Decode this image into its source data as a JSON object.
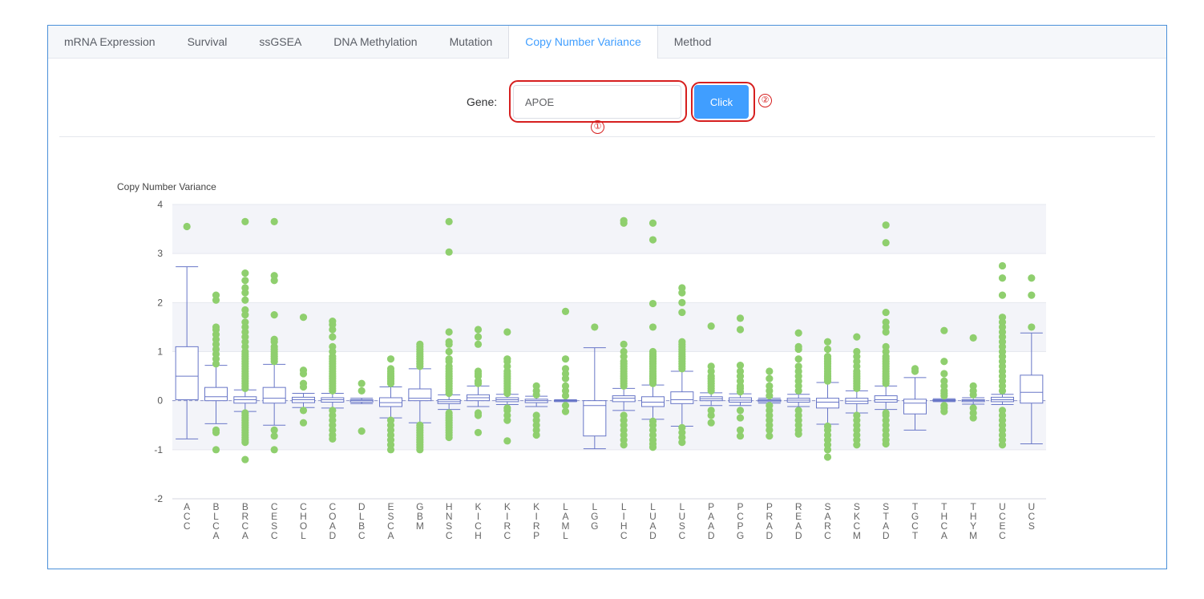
{
  "tabs": [
    {
      "label": "mRNA Expression",
      "active": false
    },
    {
      "label": "Survival",
      "active": false
    },
    {
      "label": "ssGSEA",
      "active": false
    },
    {
      "label": "DNA Methylation",
      "active": false
    },
    {
      "label": "Mutation",
      "active": false
    },
    {
      "label": "Copy Number Variance",
      "active": true
    },
    {
      "label": "Method",
      "active": false
    }
  ],
  "form": {
    "gene_label": "Gene:",
    "gene_value": "APOE",
    "button_label": "Click"
  },
  "annotations": {
    "marker1": "①",
    "marker2": "②",
    "color": "#d61f1f"
  },
  "colors": {
    "accent": "#409eff",
    "box": "#6876c7",
    "outlier": "#8fcf6e",
    "band": "#f3f4f9"
  },
  "chart_data": {
    "type": "boxplot",
    "ylabel": "Copy Number Variance",
    "ylim": [
      -2,
      4
    ],
    "yticks": [
      4,
      3,
      2,
      1,
      0,
      -1,
      -2
    ],
    "series": [
      {
        "cat": "ACC",
        "box": [
          -0.78,
          0.02,
          0.5,
          1.1,
          2.73
        ],
        "outliers": [
          3.55
        ]
      },
      {
        "cat": "BLCA",
        "box": [
          -0.47,
          0.0,
          0.08,
          0.27,
          0.72
        ],
        "outliers": [
          -1.0,
          -0.6,
          -0.65,
          0.75,
          0.85,
          0.95,
          1.05,
          1.15,
          1.25,
          1.35,
          1.45,
          1.5,
          2.05,
          2.15
        ]
      },
      {
        "cat": "BRCA",
        "box": [
          -0.22,
          -0.05,
          0.02,
          0.08,
          0.22
        ],
        "outliers": [
          -1.2,
          -0.85,
          -0.8,
          -0.75,
          -0.7,
          -0.65,
          -0.6,
          -0.55,
          -0.5,
          -0.45,
          -0.4,
          -0.35,
          -0.3,
          -0.25,
          0.25,
          0.3,
          0.35,
          0.4,
          0.45,
          0.5,
          0.55,
          0.6,
          0.65,
          0.7,
          0.75,
          0.8,
          0.85,
          0.9,
          0.95,
          1.0,
          1.1,
          1.2,
          1.3,
          1.4,
          1.5,
          1.6,
          1.75,
          1.85,
          2.05,
          2.2,
          2.3,
          2.45,
          2.6,
          3.65
        ]
      },
      {
        "cat": "CESC",
        "box": [
          -0.5,
          -0.05,
          0.05,
          0.27,
          0.74
        ],
        "outliers": [
          -1.0,
          -0.72,
          -0.6,
          0.8,
          0.85,
          0.9,
          0.95,
          1.0,
          1.05,
          1.1,
          1.2,
          1.25,
          1.75,
          2.45,
          2.55,
          3.65
        ]
      },
      {
        "cat": "CHOL",
        "box": [
          -0.14,
          -0.04,
          0.02,
          0.07,
          0.15
        ],
        "outliers": [
          -0.45,
          -0.2,
          0.28,
          0.35,
          0.55,
          0.62,
          1.7
        ]
      },
      {
        "cat": "COAD",
        "box": [
          -0.15,
          -0.03,
          0.02,
          0.06,
          0.15
        ],
        "outliers": [
          -0.78,
          -0.7,
          -0.6,
          -0.5,
          -0.4,
          -0.3,
          -0.2,
          0.2,
          0.25,
          0.3,
          0.35,
          0.4,
          0.45,
          0.5,
          0.55,
          0.6,
          0.65,
          0.7,
          0.75,
          0.8,
          0.85,
          0.9,
          1.0,
          1.1,
          1.3,
          1.45,
          1.55,
          1.62
        ]
      },
      {
        "cat": "DLBC",
        "box": [
          -0.06,
          -0.03,
          0.0,
          0.02,
          0.05
        ],
        "outliers": [
          -0.62,
          0.2,
          0.35
        ]
      },
      {
        "cat": "ESCA",
        "box": [
          -0.35,
          -0.12,
          -0.04,
          0.06,
          0.28
        ],
        "outliers": [
          -1.0,
          -0.9,
          -0.8,
          -0.7,
          -0.6,
          -0.5,
          -0.4,
          0.35,
          0.4,
          0.45,
          0.5,
          0.55,
          0.6,
          0.65,
          0.85
        ]
      },
      {
        "cat": "GBM",
        "box": [
          -0.45,
          0.0,
          0.05,
          0.24,
          0.65
        ],
        "outliers": [
          -1.0,
          -0.95,
          -0.9,
          -0.85,
          -0.8,
          -0.75,
          -0.7,
          -0.65,
          -0.6,
          -0.55,
          -0.5,
          0.7,
          0.75,
          0.8,
          0.85,
          0.9,
          0.95,
          1.0,
          1.05,
          1.1,
          1.15
        ]
      },
      {
        "cat": "HNSC",
        "box": [
          -0.18,
          -0.06,
          -0.02,
          0.02,
          0.12
        ],
        "outliers": [
          -0.75,
          -0.7,
          -0.65,
          -0.6,
          -0.55,
          -0.5,
          -0.45,
          -0.4,
          -0.35,
          -0.3,
          -0.25,
          0.15,
          0.2,
          0.25,
          0.3,
          0.35,
          0.4,
          0.45,
          0.5,
          0.55,
          0.6,
          0.65,
          0.7,
          0.8,
          0.85,
          1.0,
          1.15,
          1.2,
          1.4,
          3.03,
          3.65
        ]
      },
      {
        "cat": "KICH",
        "box": [
          -0.12,
          0.0,
          0.06,
          0.12,
          0.3
        ],
        "outliers": [
          -0.65,
          -0.3,
          -0.25,
          0.35,
          0.4,
          0.5,
          0.55,
          0.6,
          1.15,
          1.3,
          1.45
        ]
      },
      {
        "cat": "KIRC",
        "box": [
          -0.08,
          -0.02,
          0.02,
          0.06,
          0.13
        ],
        "outliers": [
          -0.82,
          -0.4,
          -0.3,
          -0.2,
          -0.15,
          0.15,
          0.2,
          0.25,
          0.3,
          0.35,
          0.4,
          0.45,
          0.5,
          0.55,
          0.6,
          0.7,
          0.8,
          0.85,
          1.4
        ]
      },
      {
        "cat": "KIRP",
        "box": [
          -0.12,
          -0.04,
          0.0,
          0.03,
          0.09
        ],
        "outliers": [
          -0.7,
          -0.6,
          -0.5,
          -0.4,
          -0.3,
          0.12,
          0.2,
          0.3
        ]
      },
      {
        "cat": "LAML",
        "box": [
          -0.02,
          -0.01,
          0.0,
          0.01,
          0.02
        ],
        "outliers": [
          -0.22,
          -0.1,
          0.1,
          0.2,
          0.3,
          0.45,
          0.55,
          0.65,
          0.85,
          1.82
        ]
      },
      {
        "cat": "LGG",
        "box": [
          -0.98,
          -0.72,
          -0.1,
          0.0,
          1.08
        ],
        "outliers": [
          1.5
        ]
      },
      {
        "cat": "LIHC",
        "box": [
          -0.2,
          -0.02,
          0.05,
          0.1,
          0.25
        ],
        "outliers": [
          -0.9,
          -0.8,
          -0.7,
          -0.6,
          -0.5,
          -0.4,
          -0.3,
          0.3,
          0.35,
          0.4,
          0.45,
          0.5,
          0.55,
          0.6,
          0.65,
          0.7,
          0.75,
          0.8,
          0.9,
          1.0,
          1.15,
          3.62,
          3.67
        ]
      },
      {
        "cat": "LUAD",
        "box": [
          -0.38,
          -0.12,
          -0.03,
          0.08,
          0.32
        ],
        "outliers": [
          -0.95,
          -0.88,
          -0.8,
          -0.7,
          -0.6,
          -0.5,
          -0.42,
          0.35,
          0.4,
          0.45,
          0.5,
          0.55,
          0.6,
          0.65,
          0.7,
          0.75,
          0.8,
          0.85,
          0.9,
          0.95,
          1.0,
          1.5,
          1.98,
          3.28,
          3.62
        ]
      },
      {
        "cat": "LUSC",
        "box": [
          -0.52,
          -0.06,
          0.02,
          0.18,
          0.6
        ],
        "outliers": [
          -0.85,
          -0.75,
          -0.65,
          -0.55,
          0.65,
          0.7,
          0.75,
          0.8,
          0.85,
          0.9,
          0.95,
          1.0,
          1.05,
          1.1,
          1.15,
          1.2,
          1.8,
          2.0,
          2.2,
          2.3
        ]
      },
      {
        "cat": "PAAD",
        "box": [
          -0.1,
          0.0,
          0.04,
          0.08,
          0.16
        ],
        "outliers": [
          -0.45,
          -0.3,
          -0.2,
          0.2,
          0.25,
          0.3,
          0.35,
          0.4,
          0.45,
          0.5,
          0.6,
          0.7,
          1.52
        ]
      },
      {
        "cat": "PCPG",
        "box": [
          -0.1,
          -0.03,
          0.01,
          0.06,
          0.14
        ],
        "outliers": [
          -0.72,
          -0.6,
          -0.35,
          -0.2,
          0.18,
          0.25,
          0.3,
          0.4,
          0.5,
          0.6,
          0.72,
          1.45,
          1.68
        ]
      },
      {
        "cat": "PRAD",
        "box": [
          -0.05,
          -0.02,
          0.0,
          0.02,
          0.05
        ],
        "outliers": [
          -0.72,
          -0.6,
          -0.5,
          -0.4,
          -0.3,
          -0.2,
          -0.1,
          0.1,
          0.2,
          0.3,
          0.45,
          0.6
        ]
      },
      {
        "cat": "READ",
        "box": [
          -0.12,
          -0.03,
          0.01,
          0.05,
          0.13
        ],
        "outliers": [
          -0.68,
          -0.6,
          -0.5,
          -0.4,
          -0.3,
          -0.2,
          0.2,
          0.3,
          0.4,
          0.5,
          0.6,
          0.7,
          0.85,
          1.05,
          1.1,
          1.38
        ]
      },
      {
        "cat": "SARC",
        "box": [
          -0.48,
          -0.15,
          -0.03,
          0.05,
          0.37
        ],
        "outliers": [
          -1.15,
          -1.0,
          -0.9,
          -0.8,
          -0.7,
          -0.6,
          -0.52,
          0.4,
          0.45,
          0.5,
          0.55,
          0.6,
          0.65,
          0.7,
          0.75,
          0.8,
          0.85,
          0.9,
          1.05,
          1.2
        ]
      },
      {
        "cat": "SKCM",
        "box": [
          -0.25,
          -0.06,
          -0.01,
          0.05,
          0.2
        ],
        "outliers": [
          -0.9,
          -0.8,
          -0.7,
          -0.6,
          -0.5,
          -0.4,
          -0.3,
          0.25,
          0.3,
          0.35,
          0.4,
          0.45,
          0.5,
          0.55,
          0.6,
          0.7,
          0.8,
          0.9,
          1.0,
          1.3
        ]
      },
      {
        "cat": "STAD",
        "box": [
          -0.18,
          -0.03,
          0.02,
          0.1,
          0.3
        ],
        "outliers": [
          -0.88,
          -0.8,
          -0.7,
          -0.6,
          -0.5,
          -0.4,
          -0.3,
          -0.25,
          0.35,
          0.4,
          0.45,
          0.5,
          0.55,
          0.6,
          0.65,
          0.7,
          0.75,
          0.8,
          0.85,
          0.9,
          1.0,
          1.1,
          1.4,
          1.5,
          1.6,
          1.8,
          3.22,
          3.58
        ]
      },
      {
        "cat": "TGCT",
        "box": [
          -0.6,
          -0.27,
          -0.05,
          0.03,
          0.47
        ],
        "outliers": [
          0.6,
          0.65
        ]
      },
      {
        "cat": "THCA",
        "box": [
          -0.02,
          0.0,
          0.01,
          0.02,
          0.04
        ],
        "outliers": [
          -0.22,
          -0.15,
          -0.1,
          0.1,
          0.15,
          0.2,
          0.3,
          0.4,
          0.55,
          0.8,
          1.43
        ]
      },
      {
        "cat": "THYM",
        "box": [
          -0.07,
          -0.02,
          0.0,
          0.02,
          0.06
        ],
        "outliers": [
          -0.35,
          -0.25,
          -0.15,
          0.12,
          0.2,
          0.3,
          1.28
        ]
      },
      {
        "cat": "UCEC",
        "box": [
          -0.08,
          -0.02,
          0.02,
          0.07,
          0.13
        ],
        "outliers": [
          -0.9,
          -0.8,
          -0.7,
          -0.6,
          -0.5,
          -0.4,
          -0.3,
          -0.2,
          0.2,
          0.3,
          0.4,
          0.5,
          0.6,
          0.7,
          0.8,
          0.9,
          1.0,
          1.1,
          1.2,
          1.3,
          1.4,
          1.5,
          1.6,
          1.7,
          2.15,
          2.5,
          2.75
        ]
      },
      {
        "cat": "UCS",
        "box": [
          -0.88,
          -0.05,
          0.17,
          0.52,
          1.38
        ],
        "outliers": [
          1.5,
          2.15,
          2.5
        ]
      }
    ]
  }
}
